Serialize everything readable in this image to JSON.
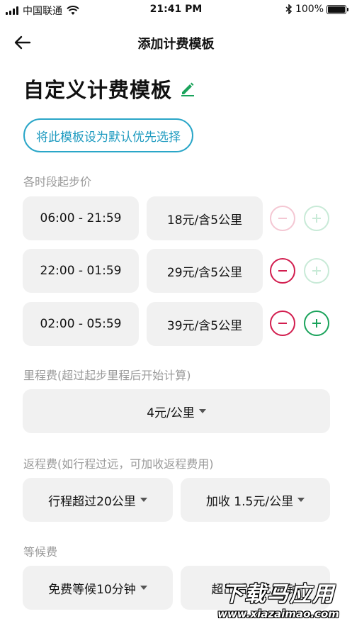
{
  "status_bar": {
    "carrier": "中国联通",
    "time": "21:41 PM",
    "battery": "100%"
  },
  "nav": {
    "title": "添加计费模板"
  },
  "page_title": "自定义计费模板",
  "default_button_label": "将此模板设为默认优先选择",
  "sections": {
    "time_slots_label": "各时段起步价",
    "mileage_label": "里程费(超过起步里程后开始计算)",
    "return_label": "返程费(如行程过远，可加收返程费用)",
    "waiting_label": "等候费"
  },
  "time_slots": [
    {
      "range": "06:00 - 21:59",
      "price": "18元/含5公里"
    },
    {
      "range": "22:00 - 01:59",
      "price": "29元/含5公里"
    },
    {
      "range": "02:00 - 05:59",
      "price": "39元/含5公里"
    }
  ],
  "mileage_value": "4元/公里",
  "return_fee": {
    "threshold": "行程超过20公里",
    "surcharge": "加收 1.5元/公里"
  },
  "waiting_fee": {
    "free": "免费等候10分钟",
    "extra": "超出后 1元/分钟"
  },
  "watermark": {
    "title": "下载马应用",
    "site": "www.xiazaimao.com"
  },
  "colors": {
    "accent_blue": "#1f9bc0",
    "edit_green": "#1aa35b",
    "minus_red": "#d21d4e",
    "plus_green": "#1aa35b",
    "pill_bg": "#f1f1f1"
  }
}
